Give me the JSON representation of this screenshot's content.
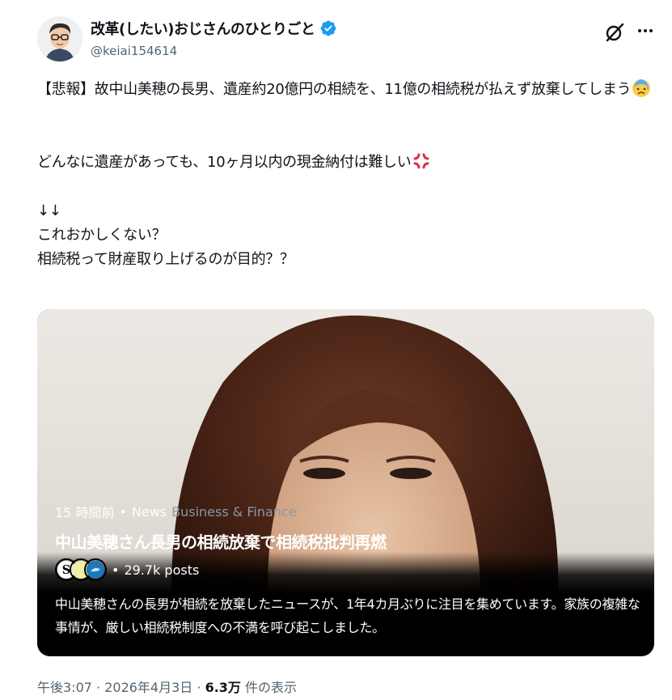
{
  "author": {
    "name": "改革(したい)おじさんのひとりごと",
    "handle": "@keiai154614",
    "verified_color": "#1d9bf0"
  },
  "icons": {
    "grok": "grok-icon",
    "more": "more-icon",
    "verified": "verified-badge-icon",
    "emoji_sweat": "anxious-face-with-sweat-emoji",
    "emoji_anger": "anger-symbol-emoji"
  },
  "tweet": {
    "line1": "【悲報】故中山美穂の長男、遺産約20億円の相続を、11億の相続税が払えず放棄してしまう",
    "line2": "どんなに遺産があっても、10ヶ月以内の現金納付は難しい",
    "line3": "↓↓",
    "line4": "これおかしくない？",
    "line5": "相続税って財産取り上げるのが目的？？"
  },
  "card": {
    "time": "15 時間前",
    "sep": "•",
    "source": "News",
    "category": "Business & Finance",
    "title": "中山美穂さん長男の相続放棄で相続税批判再燃",
    "posts": "29.7k posts",
    "summary": "中山美穂さんの長男が相続を放棄したニュースが、1年4カ月ぶりに注目を集めています。家族の複雑な事情が、厳しい相続税制度への不満を呼び起こしました。"
  },
  "footer": {
    "time": "午後3:07",
    "date": "2026年4月3日",
    "views": "6.3万",
    "views_label": "件の表示"
  }
}
